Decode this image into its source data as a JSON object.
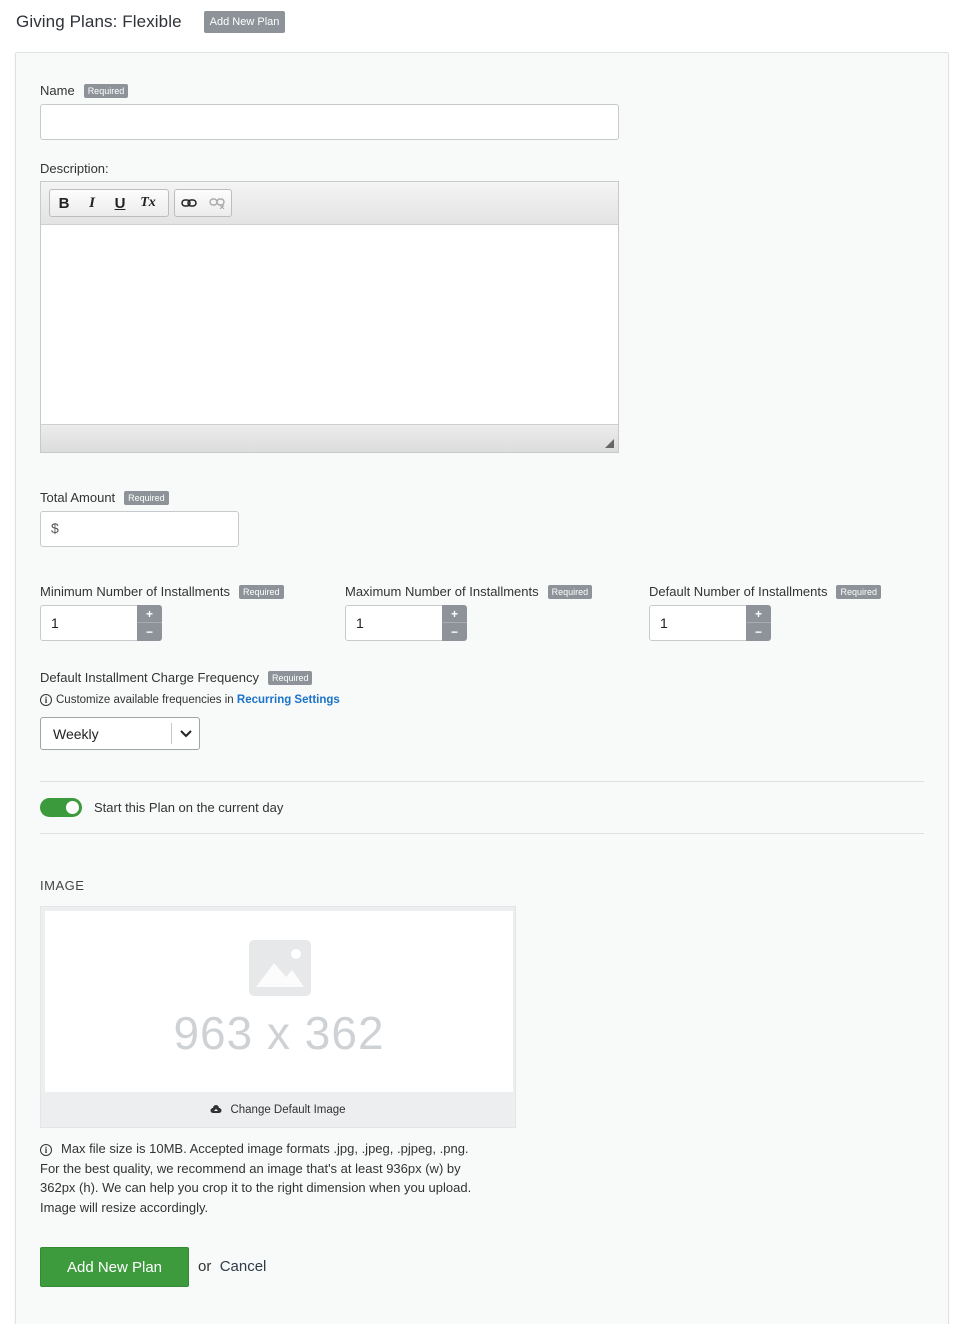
{
  "header": {
    "title": "Giving Plans: Flexible",
    "add_button": "Add New Plan"
  },
  "required_badge": "Required",
  "name": {
    "label": "Name",
    "value": ""
  },
  "description": {
    "label": "Description:",
    "toolbar": {
      "bold": "B",
      "italic": "I",
      "underline": "U",
      "clear_format": "Tx"
    }
  },
  "total_amount": {
    "label": "Total Amount",
    "prefix": "$",
    "value": ""
  },
  "installments": {
    "min": {
      "label": "Minimum Number of Installments",
      "value": "1"
    },
    "max": {
      "label": "Maximum Number of Installments",
      "value": "1"
    },
    "default": {
      "label": "Default Number of Installments",
      "value": "1"
    },
    "plus": "+",
    "minus": "−"
  },
  "frequency": {
    "label": "Default Installment Charge Frequency",
    "hint_prefix": "Customize available frequencies in",
    "hint_link": "Recurring Settings",
    "selected": "Weekly"
  },
  "start_toggle": {
    "label": "Start this Plan on the current day",
    "on": true
  },
  "image": {
    "heading": "IMAGE",
    "placeholder_size": "963 x 362",
    "change_button": "Change Default Image",
    "help_lines": [
      "Max file size is 10MB. Accepted image formats .jpg, .jpeg, .pjpeg, .png.",
      "For the best quality, we recommend an image that's at least 936px (w) by",
      "362px (h). We can help you crop it to the right dimension when you upload.",
      "Image will resize accordingly."
    ]
  },
  "actions": {
    "submit": "Add New Plan",
    "or": "or",
    "cancel": "Cancel"
  },
  "colors": {
    "accent_green": "#3d9a3d",
    "link_blue": "#1a73c8",
    "badge_gray": "#8d9399"
  }
}
